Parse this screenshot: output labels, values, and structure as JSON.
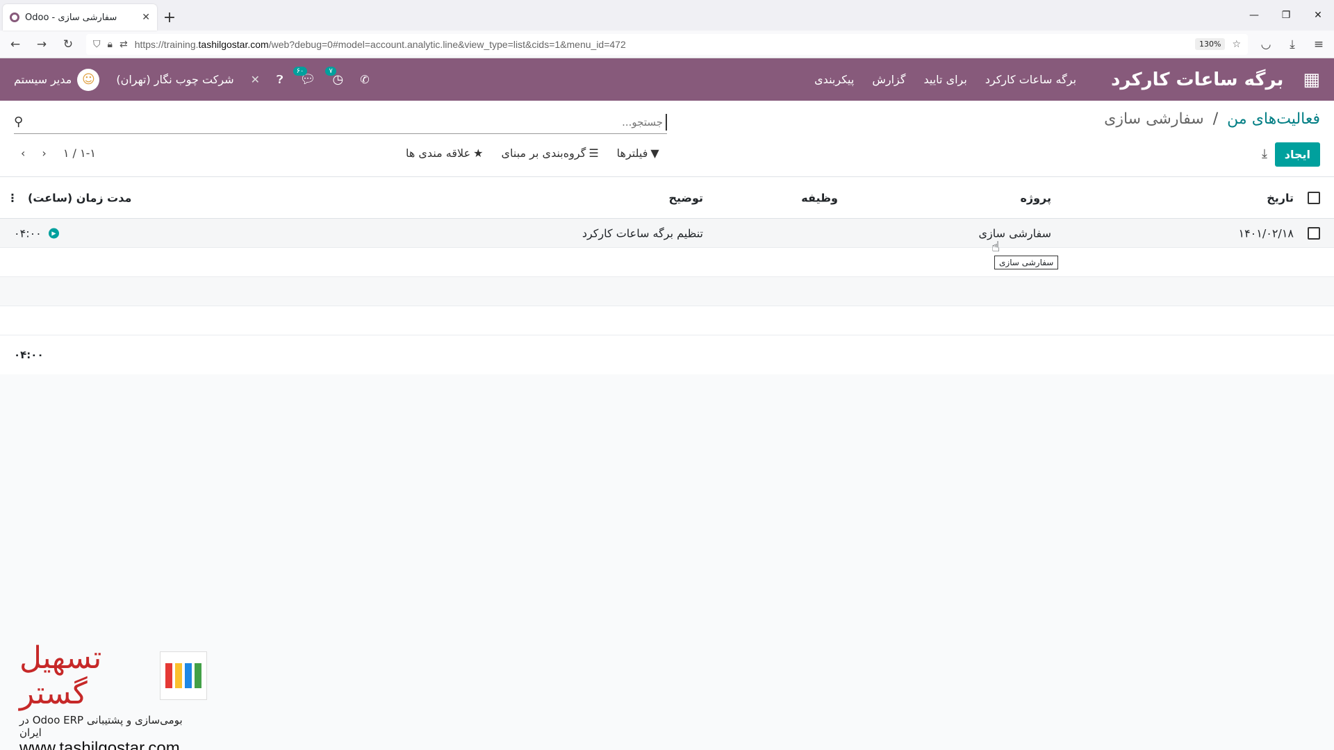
{
  "browser": {
    "tab_title": "Odoo - سفارشی سازی",
    "url_prefix": "https://training.",
    "url_domain": "tashilgostar.com",
    "url_suffix": "/web?debug=0#model=account.analytic.line&view_type=list&cids=1&menu_id=472",
    "zoom": "130%"
  },
  "nav": {
    "app_title": "برگه ساعات کارکرد",
    "menu": [
      "برگه ساعات کارکرد",
      "برای تایید",
      "گزارش",
      "پیکربندی"
    ],
    "user": "مدیر سیستم",
    "company": "شرکت چوب نگار (تهران)",
    "messages_count": "۶۰",
    "activities_count": "۷"
  },
  "control_panel": {
    "breadcrumb_parent": "فعالیت‌های من",
    "breadcrumb_current": "سفارشی سازی",
    "search_placeholder": "جستجو...",
    "create_label": "ایجاد",
    "filters_label": "فیلترها",
    "groupby_label": "گروه‌بندی بر مبنای",
    "favorites_label": "علاقه مندی ها",
    "pager": "۱-۱ / ۱"
  },
  "table": {
    "columns": {
      "date": "تاریخ",
      "project": "پروژه",
      "task": "وظیفه",
      "description": "توضیح",
      "duration": "مدت زمان (ساعت)"
    },
    "rows": [
      {
        "date": "۱۴۰۱/۰۲/۱۸",
        "project": "سفارشی سازی",
        "task": "",
        "description": "تنظیم برگه ساعات کارکرد",
        "duration": "۰۴:۰۰"
      }
    ],
    "total": "۰۴:۰۰",
    "tooltip": "سفارشی سازی"
  },
  "watermark": {
    "name": "تسهیل گستر",
    "tagline": "بومی‌سازی و پشتیبانی Odoo ERP در ایران",
    "url": "www.tashilgostar.com"
  }
}
